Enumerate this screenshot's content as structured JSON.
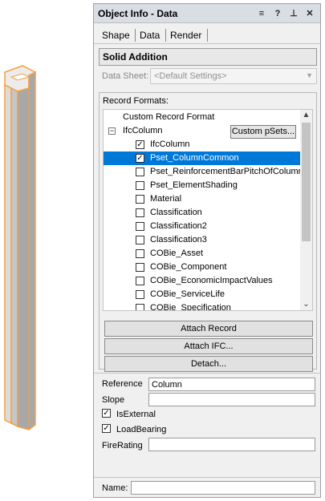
{
  "window": {
    "title": "Object Info - Data",
    "menu_icon": "≡",
    "help_icon": "?",
    "pin_icon": "⊥",
    "close_icon": "✕"
  },
  "tabs": [
    {
      "label": "Shape",
      "active": false
    },
    {
      "label": "Data",
      "active": true
    },
    {
      "label": "Render",
      "active": false
    }
  ],
  "object_type": "Solid Addition",
  "data_sheet": {
    "label": "Data Sheet:",
    "value": "<Default Settings>"
  },
  "record_formats": {
    "label": "Record Formats:",
    "custom_record_format": "Custom Record Format",
    "ifc_entity": "IfcColumn",
    "custom_psets_button": "Custom pSets...",
    "items": [
      {
        "label": "IfcColumn",
        "checked": true,
        "selected": false
      },
      {
        "label": "Pset_ColumnCommon",
        "checked": true,
        "selected": true
      },
      {
        "label": "Pset_ReinforcementBarPitchOfColumn",
        "checked": false,
        "selected": false
      },
      {
        "label": "Pset_ElementShading",
        "checked": false,
        "selected": false
      },
      {
        "label": "Material",
        "checked": false,
        "selected": false
      },
      {
        "label": "Classification",
        "checked": false,
        "selected": false
      },
      {
        "label": "Classification2",
        "checked": false,
        "selected": false
      },
      {
        "label": "Classification3",
        "checked": false,
        "selected": false
      },
      {
        "label": "COBie_Asset",
        "checked": false,
        "selected": false
      },
      {
        "label": "COBie_Component",
        "checked": false,
        "selected": false
      },
      {
        "label": "COBie_EconomicImpactValues",
        "checked": false,
        "selected": false
      },
      {
        "label": "COBie_ServiceLife",
        "checked": false,
        "selected": false
      },
      {
        "label": "COBie_Specification",
        "checked": false,
        "selected": false
      }
    ]
  },
  "buttons": {
    "attach_record": "Attach Record",
    "attach_ifc": "Attach IFC...",
    "detach": "Detach..."
  },
  "fields": {
    "reference_label": "Reference",
    "reference_value": "Column",
    "slope_label": "Slope",
    "slope_value": "",
    "is_external_label": "IsExternal",
    "is_external_checked": true,
    "load_bearing_label": "LoadBearing",
    "load_bearing_checked": true,
    "fire_rating_label": "FireRating",
    "fire_rating_value": ""
  },
  "name_field": {
    "label": "Name:",
    "value": ""
  },
  "colors": {
    "selection": "#0078d7",
    "outline": "#f5a041",
    "column_face": "#a8a8a8"
  }
}
